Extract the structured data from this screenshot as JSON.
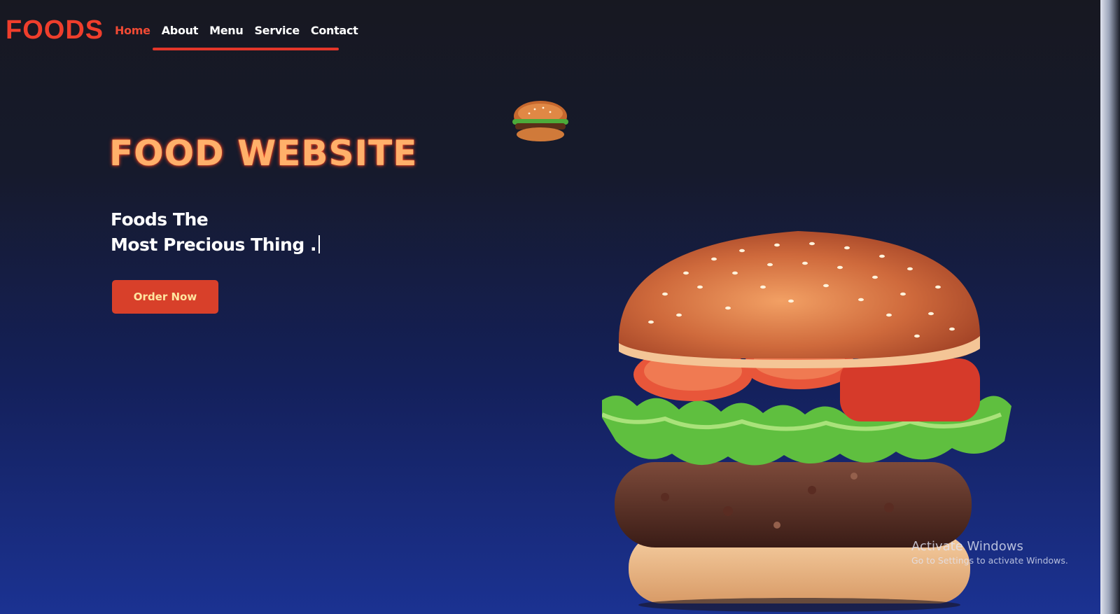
{
  "brand": {
    "logo": "FOODS"
  },
  "nav": {
    "items": [
      {
        "label": "Home",
        "active": true
      },
      {
        "label": "About",
        "active": false
      },
      {
        "label": "Menu",
        "active": false
      },
      {
        "label": "Service",
        "active": false
      },
      {
        "label": "Contact",
        "active": false
      }
    ]
  },
  "hero": {
    "title": "FOOD WEBSITE",
    "subtitle_line1": "Foods The",
    "subtitle_line2": "Most Precious Thing .",
    "cta_label": "Order Now"
  },
  "watermark": {
    "title": "Activate Windows",
    "subtitle": "Go to Settings to activate Windows."
  },
  "colors": {
    "accent": "#ef3e2c",
    "title_glow": "#ffb06a",
    "background_top": "#171821",
    "background_bottom": "#1b3292"
  },
  "icons": {
    "small_image": "burger-icon",
    "hero_image": "burger-illustration"
  }
}
